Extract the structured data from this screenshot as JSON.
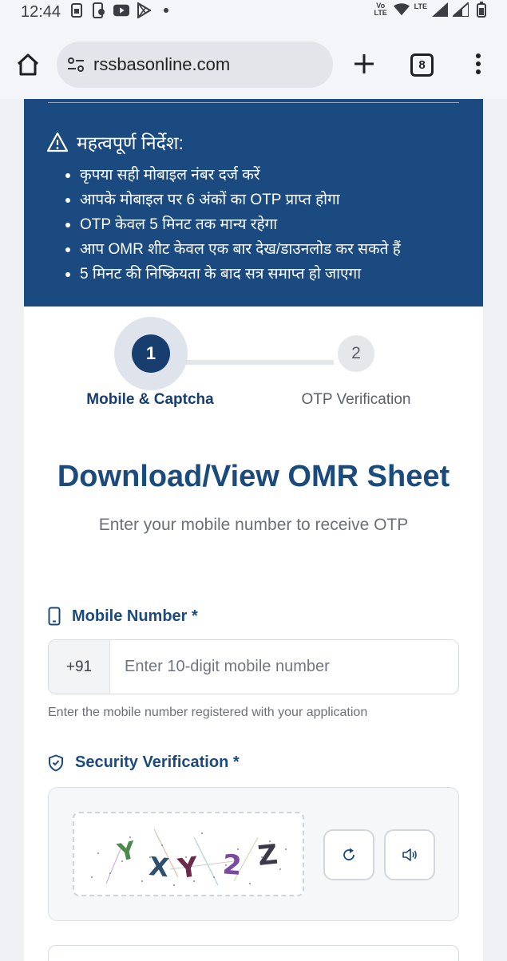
{
  "status_bar": {
    "time": "12:44",
    "network_label": "Vo LTE",
    "lte_label": "LTE"
  },
  "browser": {
    "url": "rssbasonline.com",
    "tab_count": "8"
  },
  "instructions": {
    "title": "महत्वपूर्ण निर्देश:",
    "items": [
      "कृपया सही मोबाइल नंबर दर्ज करें",
      "आपके मोबाइल पर 6 अंकों का OTP प्राप्त होगा",
      "OTP केवल 5 मिनट तक मान्य रहेगा",
      "आप OMR शीट केवल एक बार देख/डाउनलोड कर सकते हैं",
      "5 मिनट की निष्क्रियता के बाद सत्र समाप्त हो जाएगा"
    ]
  },
  "stepper": {
    "steps": [
      {
        "number": "1",
        "label": "Mobile & Captcha"
      },
      {
        "number": "2",
        "label": "OTP Verification"
      }
    ]
  },
  "form": {
    "title": "Download/View OMR Sheet",
    "subtitle": "Enter your mobile number to receive OTP",
    "mobile_label": "Mobile Number *",
    "country_code": "+91",
    "mobile_placeholder": "Enter 10-digit mobile number",
    "mobile_help": "Enter the mobile number registered with your application",
    "security_label": "Security Verification *",
    "captcha_text": [
      "Y",
      "X",
      "Y",
      "2",
      "Z"
    ]
  },
  "colors": {
    "primary": "#1a4a80",
    "accent_text": "#1b4a7d"
  }
}
